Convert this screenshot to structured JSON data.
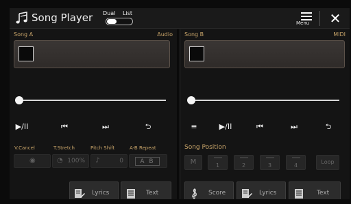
{
  "header": {
    "title": "Song Player",
    "dual_label": "Dual",
    "list_label": "List",
    "menu_label": "Menu",
    "close_glyph": "✕"
  },
  "song_a": {
    "label": "Song A",
    "type": "Audio",
    "controls": [
      "▶/II",
      "⏮",
      "⏭",
      "⮌"
    ],
    "section_labels": [
      "V.Cancel",
      "T.Stretch",
      "Pitch Shift",
      "A-B Repeat"
    ],
    "tstretch_value": "100%",
    "pitch_value": "0",
    "ab_value": "A B",
    "bottom": [
      "Lyrics",
      "Text"
    ]
  },
  "song_b": {
    "label": "Song B",
    "type": "MIDI",
    "controls": [
      "≡",
      "▶/II",
      "⏮",
      "⏭",
      "⮌"
    ],
    "song_position_label": "Song Position",
    "m_label": "M",
    "positions": [
      "1",
      "2",
      "3",
      "4"
    ],
    "loop_label": "Loop",
    "bottom": [
      "Score",
      "Lyrics",
      "Text"
    ]
  },
  "icons": {
    "title_icon": "music-note-icon",
    "menu_icon": "hamburger-menu-icon",
    "close_icon": "close-icon",
    "lyrics_icon": "lyrics-icon",
    "text_icon": "text-document-icon",
    "score_icon": "treble-clef-icon"
  },
  "colors": {
    "accent": "#c9a56a",
    "background": "#111111"
  }
}
